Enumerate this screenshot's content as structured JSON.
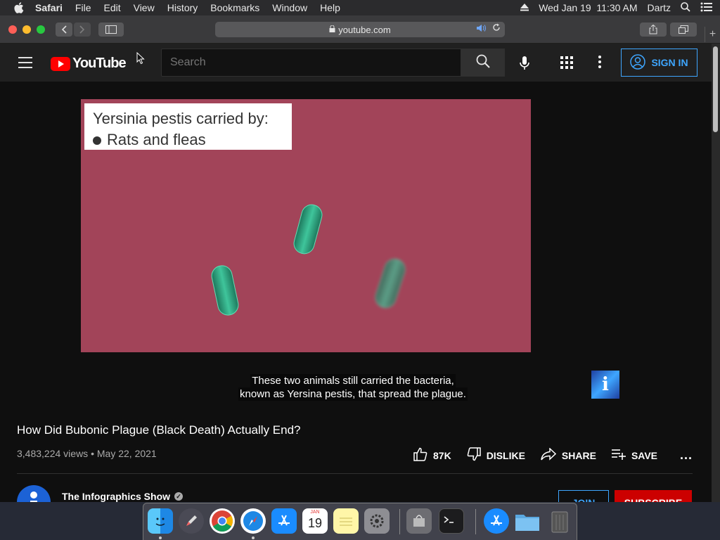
{
  "menubar": {
    "app_name": "Safari",
    "items": [
      "File",
      "Edit",
      "View",
      "History",
      "Bookmarks",
      "Window",
      "Help"
    ],
    "datetime": "Wed Jan 19  11:30 AM",
    "user": "Dartz"
  },
  "browser": {
    "url": "youtube.com"
  },
  "youtube": {
    "logo_text": "YouTube",
    "search_placeholder": "Search",
    "sign_in_label": "SIGN IN"
  },
  "video": {
    "slide_title": "Yersinia pestis carried by:",
    "slide_bullet": "Rats and fleas",
    "caption_line1": "These two animals still carried the bacteria,",
    "caption_line2": "known as Yersina pestis, that spread the plague.",
    "title": "How Did Bubonic Plague (Black Death) Actually End?",
    "views": "3,483,224 views",
    "date": "May 22, 2021",
    "likes": "87K",
    "dislike_label": "DISLIKE",
    "share_label": "SHARE",
    "save_label": "SAVE",
    "more_label": "..."
  },
  "channel": {
    "name": "The Infographics Show",
    "join_label": "JOIN",
    "subscribe_label": "SUBSCRIBE"
  },
  "dock": {
    "calendar_month": "JAN",
    "calendar_day": "19"
  },
  "colors": {
    "video_bg": "#a24459",
    "accent_blue": "#3ea6ff",
    "subscribe_red": "#cc0000"
  }
}
